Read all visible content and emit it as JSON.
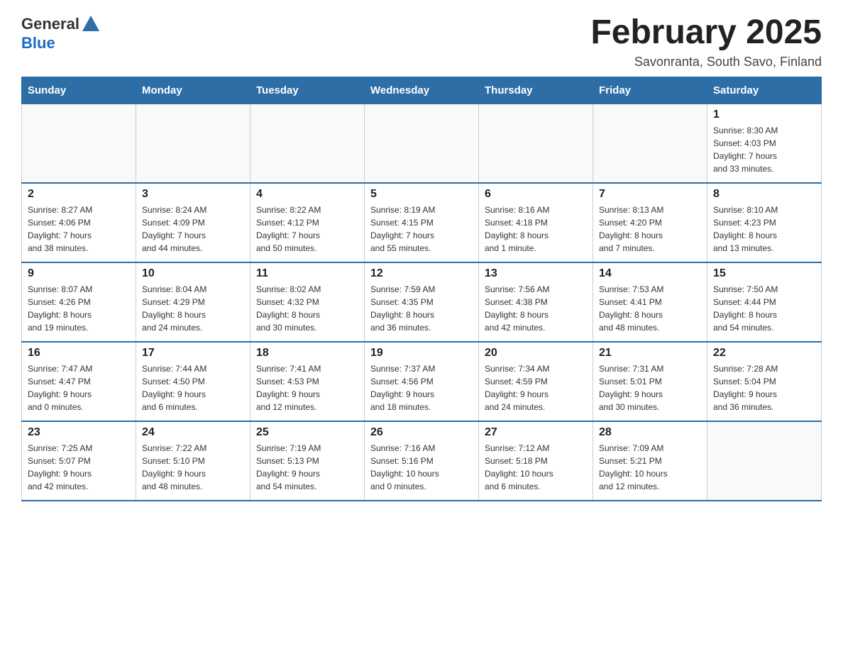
{
  "header": {
    "logo_general": "General",
    "logo_blue": "Blue",
    "month_title": "February 2025",
    "location": "Savonranta, South Savo, Finland"
  },
  "weekdays": [
    "Sunday",
    "Monday",
    "Tuesday",
    "Wednesday",
    "Thursday",
    "Friday",
    "Saturday"
  ],
  "weeks": [
    [
      {
        "day": "",
        "info": ""
      },
      {
        "day": "",
        "info": ""
      },
      {
        "day": "",
        "info": ""
      },
      {
        "day": "",
        "info": ""
      },
      {
        "day": "",
        "info": ""
      },
      {
        "day": "",
        "info": ""
      },
      {
        "day": "1",
        "info": "Sunrise: 8:30 AM\nSunset: 4:03 PM\nDaylight: 7 hours\nand 33 minutes."
      }
    ],
    [
      {
        "day": "2",
        "info": "Sunrise: 8:27 AM\nSunset: 4:06 PM\nDaylight: 7 hours\nand 38 minutes."
      },
      {
        "day": "3",
        "info": "Sunrise: 8:24 AM\nSunset: 4:09 PM\nDaylight: 7 hours\nand 44 minutes."
      },
      {
        "day": "4",
        "info": "Sunrise: 8:22 AM\nSunset: 4:12 PM\nDaylight: 7 hours\nand 50 minutes."
      },
      {
        "day": "5",
        "info": "Sunrise: 8:19 AM\nSunset: 4:15 PM\nDaylight: 7 hours\nand 55 minutes."
      },
      {
        "day": "6",
        "info": "Sunrise: 8:16 AM\nSunset: 4:18 PM\nDaylight: 8 hours\nand 1 minute."
      },
      {
        "day": "7",
        "info": "Sunrise: 8:13 AM\nSunset: 4:20 PM\nDaylight: 8 hours\nand 7 minutes."
      },
      {
        "day": "8",
        "info": "Sunrise: 8:10 AM\nSunset: 4:23 PM\nDaylight: 8 hours\nand 13 minutes."
      }
    ],
    [
      {
        "day": "9",
        "info": "Sunrise: 8:07 AM\nSunset: 4:26 PM\nDaylight: 8 hours\nand 19 minutes."
      },
      {
        "day": "10",
        "info": "Sunrise: 8:04 AM\nSunset: 4:29 PM\nDaylight: 8 hours\nand 24 minutes."
      },
      {
        "day": "11",
        "info": "Sunrise: 8:02 AM\nSunset: 4:32 PM\nDaylight: 8 hours\nand 30 minutes."
      },
      {
        "day": "12",
        "info": "Sunrise: 7:59 AM\nSunset: 4:35 PM\nDaylight: 8 hours\nand 36 minutes."
      },
      {
        "day": "13",
        "info": "Sunrise: 7:56 AM\nSunset: 4:38 PM\nDaylight: 8 hours\nand 42 minutes."
      },
      {
        "day": "14",
        "info": "Sunrise: 7:53 AM\nSunset: 4:41 PM\nDaylight: 8 hours\nand 48 minutes."
      },
      {
        "day": "15",
        "info": "Sunrise: 7:50 AM\nSunset: 4:44 PM\nDaylight: 8 hours\nand 54 minutes."
      }
    ],
    [
      {
        "day": "16",
        "info": "Sunrise: 7:47 AM\nSunset: 4:47 PM\nDaylight: 9 hours\nand 0 minutes."
      },
      {
        "day": "17",
        "info": "Sunrise: 7:44 AM\nSunset: 4:50 PM\nDaylight: 9 hours\nand 6 minutes."
      },
      {
        "day": "18",
        "info": "Sunrise: 7:41 AM\nSunset: 4:53 PM\nDaylight: 9 hours\nand 12 minutes."
      },
      {
        "day": "19",
        "info": "Sunrise: 7:37 AM\nSunset: 4:56 PM\nDaylight: 9 hours\nand 18 minutes."
      },
      {
        "day": "20",
        "info": "Sunrise: 7:34 AM\nSunset: 4:59 PM\nDaylight: 9 hours\nand 24 minutes."
      },
      {
        "day": "21",
        "info": "Sunrise: 7:31 AM\nSunset: 5:01 PM\nDaylight: 9 hours\nand 30 minutes."
      },
      {
        "day": "22",
        "info": "Sunrise: 7:28 AM\nSunset: 5:04 PM\nDaylight: 9 hours\nand 36 minutes."
      }
    ],
    [
      {
        "day": "23",
        "info": "Sunrise: 7:25 AM\nSunset: 5:07 PM\nDaylight: 9 hours\nand 42 minutes."
      },
      {
        "day": "24",
        "info": "Sunrise: 7:22 AM\nSunset: 5:10 PM\nDaylight: 9 hours\nand 48 minutes."
      },
      {
        "day": "25",
        "info": "Sunrise: 7:19 AM\nSunset: 5:13 PM\nDaylight: 9 hours\nand 54 minutes."
      },
      {
        "day": "26",
        "info": "Sunrise: 7:16 AM\nSunset: 5:16 PM\nDaylight: 10 hours\nand 0 minutes."
      },
      {
        "day": "27",
        "info": "Sunrise: 7:12 AM\nSunset: 5:18 PM\nDaylight: 10 hours\nand 6 minutes."
      },
      {
        "day": "28",
        "info": "Sunrise: 7:09 AM\nSunset: 5:21 PM\nDaylight: 10 hours\nand 12 minutes."
      },
      {
        "day": "",
        "info": ""
      }
    ]
  ]
}
